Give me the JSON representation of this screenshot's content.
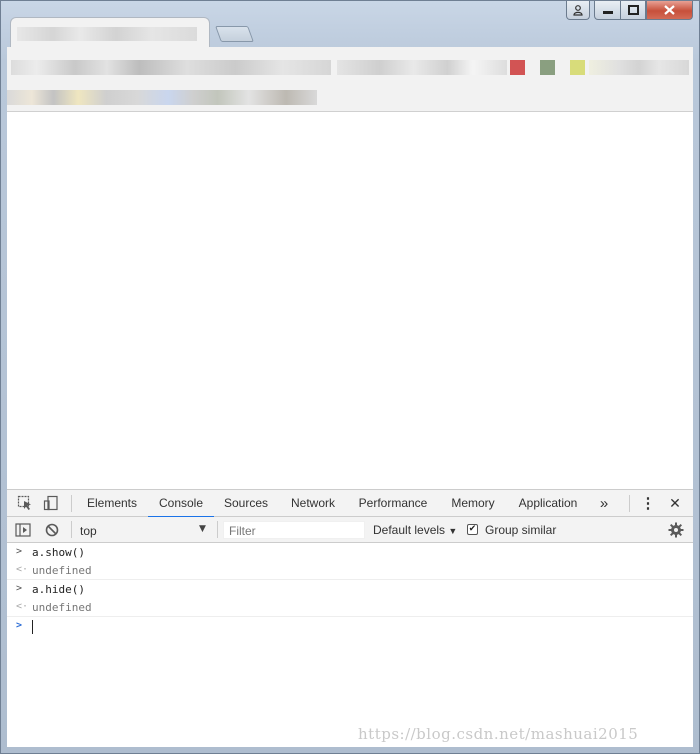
{
  "devtools": {
    "tabs": [
      {
        "label": "Elements"
      },
      {
        "label": "Console"
      },
      {
        "label": "Sources"
      },
      {
        "label": "Network"
      },
      {
        "label": "Performance"
      },
      {
        "label": "Memory"
      },
      {
        "label": "Application"
      }
    ],
    "active_tab": "Console",
    "more_tabs_glyph": "»",
    "menu_glyph": "⋮",
    "close_glyph": "✕",
    "console_bar": {
      "context": "top",
      "filter_placeholder": "Filter",
      "levels": "Default levels",
      "group_similar": "Group similar",
      "group_similar_checked": true
    },
    "console_lines": [
      {
        "kind": "input",
        "prefix": ">",
        "text": "a.show()"
      },
      {
        "kind": "output",
        "prefix": "<·",
        "text": "undefined"
      },
      {
        "kind": "input",
        "prefix": ">",
        "text": "a.hide()"
      },
      {
        "kind": "output",
        "prefix": "<·",
        "text": "undefined"
      }
    ],
    "prompt_prefix": ">"
  },
  "icons": {
    "inspect": "inspect-element-icon",
    "device": "device-toolbar-icon",
    "sidebar": "show-sidebar-icon",
    "clear": "clear-console-icon",
    "settings": "gear-icon",
    "user": "user-icon"
  },
  "colors": {
    "active_tab_underline": "#1a73e8",
    "prompt": "#2f6fd6",
    "close_button": "#c7503b"
  },
  "watermark": "https://blog.csdn.net/mashuai2015"
}
